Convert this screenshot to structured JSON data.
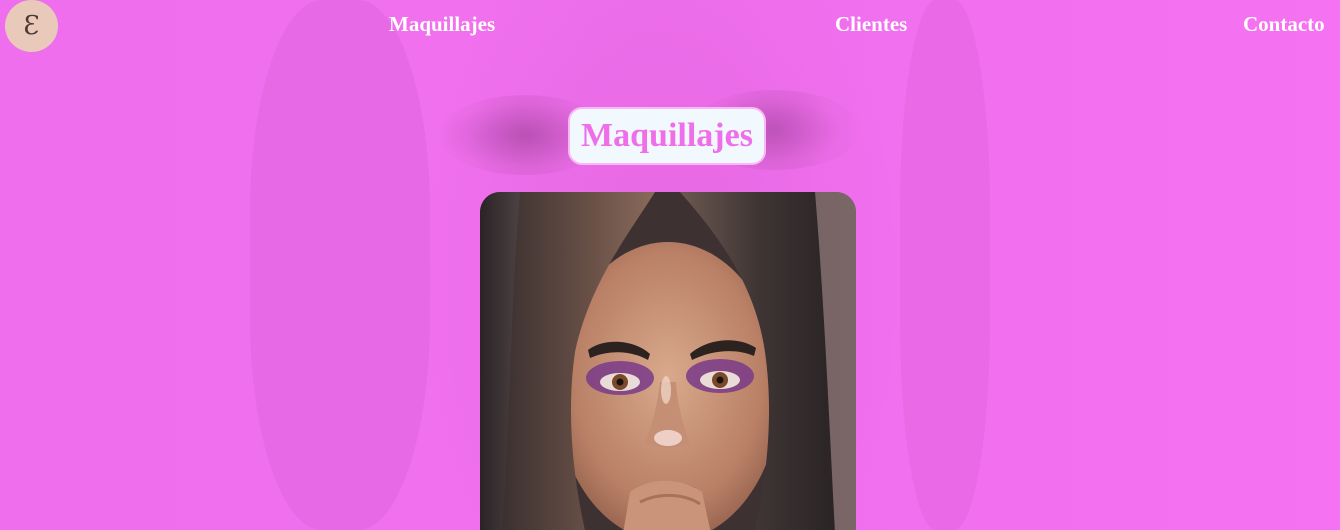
{
  "nav": {
    "logo_letter": "Ɛ",
    "links": [
      {
        "label": "Maquillajes"
      },
      {
        "label": "Clientes"
      },
      {
        "label": "Contacto"
      }
    ]
  },
  "section": {
    "title": "Maquillajes"
  },
  "colors": {
    "background": "#f26ef0",
    "title_text": "#ef6fea",
    "pill_background": "#f1f8fe",
    "nav_text": "#ffffff",
    "logo_background": "#e9c9b9"
  },
  "icons": {
    "logo": "circle-monogram"
  }
}
